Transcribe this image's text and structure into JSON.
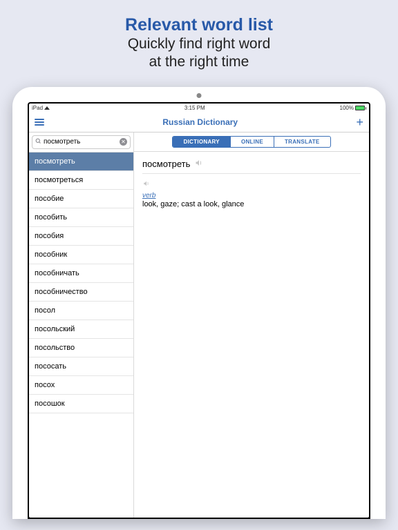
{
  "promo": {
    "title": "Relevant word list",
    "sub1": "Quickly find right word",
    "sub2": "at the right time"
  },
  "statusbar": {
    "device": "iPad",
    "time": "3:15 PM",
    "battery_pct": "100%"
  },
  "nav": {
    "title": "Russian Dictionary"
  },
  "search": {
    "value": "посмотреть"
  },
  "tabs": {
    "items": [
      {
        "label": "DICTIONARY",
        "active": true
      },
      {
        "label": "ONLINE",
        "active": false
      },
      {
        "label": "TRANSLATE",
        "active": false
      }
    ]
  },
  "wordlist": [
    "посмотреть",
    "посмотреться",
    "пособие",
    "пособить",
    "пособия",
    "пособник",
    "пособничать",
    "пособничество",
    "посол",
    "посольский",
    "посольство",
    "пососать",
    "посох",
    "посошок"
  ],
  "selected_index": 0,
  "entry": {
    "headword": "посмотреть",
    "pos": "verb",
    "definition": "look, gaze; cast a look, glance"
  }
}
